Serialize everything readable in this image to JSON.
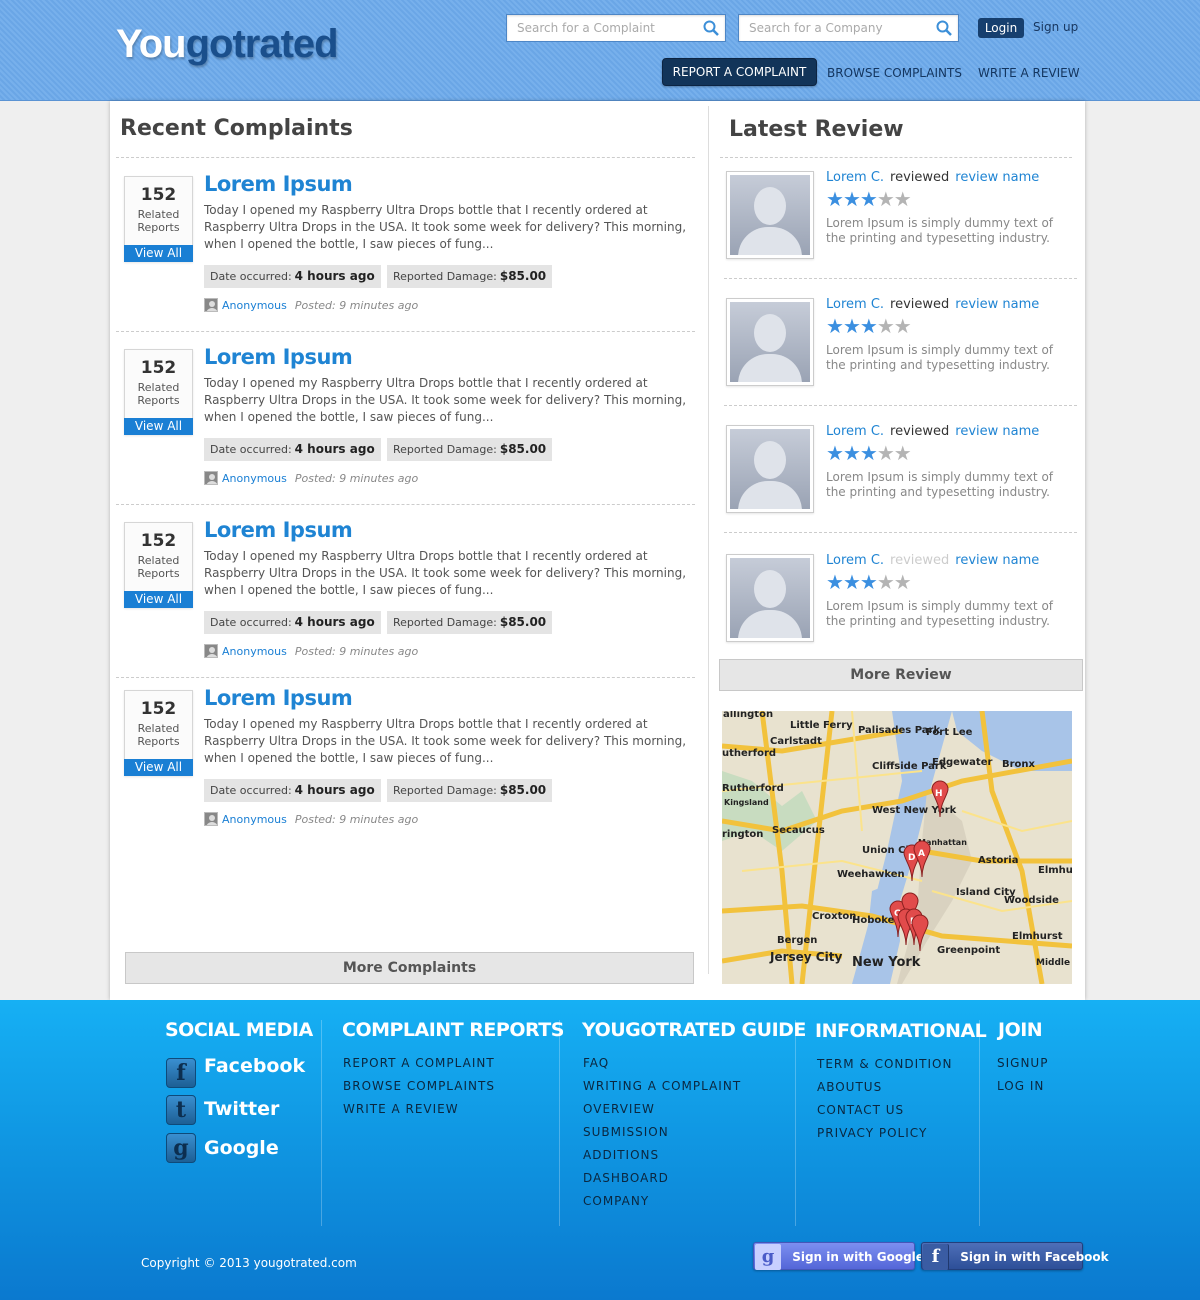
{
  "logo": {
    "part1": "You",
    "part2": "gotrated"
  },
  "header": {
    "search_complaint_placeholder": "Search for a Complaint",
    "search_company_placeholder": "Search for a Company",
    "login": "Login",
    "signup": "Sign up",
    "nav": [
      "REPORT A COMPLAINT",
      "BROWSE COMPLAINTS",
      "WRITE A REVIEW"
    ]
  },
  "recent": {
    "title": "Recent Complaints",
    "items": [
      {
        "count": "152",
        "related": "Related",
        "reports": "Reports",
        "view_all": "View All",
        "title": "Lorem Ipsum",
        "text": "Today I opened my Raspberry Ultra Drops bottle that I recently ordered at Raspberry Ultra Drops in the USA. It took some week for delivery? This morning,  when I opened the bottle, I saw pieces of fung...",
        "date_label": "Date occurred:",
        "date_value": "4 hours ago",
        "damage_label": "Reported Damage:",
        "damage_value": "$85.00",
        "poster": "Anonymous",
        "posted": "Posted: 9 minutes ago"
      },
      {
        "count": "152",
        "related": "Related",
        "reports": "Reports",
        "view_all": "View All",
        "title": "Lorem Ipsum",
        "text": "Today I opened my Raspberry Ultra Drops bottle that I recently ordered at Raspberry Ultra Drops in the USA. It took some week for delivery? This morning,  when I opened the bottle, I saw pieces of fung...",
        "date_label": "Date occurred:",
        "date_value": "4 hours ago",
        "damage_label": "Reported Damage:",
        "damage_value": "$85.00",
        "poster": "Anonymous",
        "posted": "Posted: 9 minutes ago"
      },
      {
        "count": "152",
        "related": "Related",
        "reports": "Reports",
        "view_all": "View All",
        "title": "Lorem Ipsum",
        "text": "Today I opened my Raspberry Ultra Drops bottle that I recently ordered at Raspberry Ultra Drops in the USA. It took some week for delivery? This morning,  when I opened the bottle, I saw pieces of fung...",
        "date_label": "Date occurred:",
        "date_value": "4 hours ago",
        "damage_label": "Reported Damage:",
        "damage_value": "$85.00",
        "poster": "Anonymous",
        "posted": "Posted: 9 minutes ago"
      },
      {
        "count": "152",
        "related": "Related",
        "reports": "Reports",
        "view_all": "View All",
        "title": "Lorem Ipsum",
        "text": "Today I opened my Raspberry Ultra Drops bottle that I recently ordered at Raspberry Ultra Drops in the USA. It took some week for delivery? This morning,  when I opened the bottle, I saw pieces of fung...",
        "date_label": "Date occurred:",
        "date_value": "4 hours ago",
        "damage_label": "Reported Damage:",
        "damage_value": "$85.00",
        "poster": "Anonymous",
        "posted": "Posted: 9 minutes ago"
      }
    ],
    "more": "More Complaints"
  },
  "reviews": {
    "title": "Latest Review",
    "items": [
      {
        "name": "Lorem C.",
        "reviewed": "reviewed",
        "link": "review name",
        "rating": 3,
        "max": 5,
        "text": "Lorem Ipsum is simply dummy text of the printing and typesetting industry."
      },
      {
        "name": "Lorem C.",
        "reviewed": "reviewed",
        "link": "review name",
        "rating": 3,
        "max": 5,
        "text": "Lorem Ipsum is simply dummy text of the printing and typesetting industry."
      },
      {
        "name": "Lorem C.",
        "reviewed": "reviewed",
        "link": "review name",
        "rating": 3,
        "max": 5,
        "text": "Lorem Ipsum is simply dummy text of the printing and typesetting industry."
      },
      {
        "name": "Lorem C.",
        "reviewed": "reviewed",
        "link": "review name",
        "rating": 3,
        "max": 5,
        "text": "Lorem Ipsum is simply dummy text of the printing and typesetting industry."
      }
    ],
    "more": "More Review"
  },
  "map": {
    "labels": [
      "allington",
      "Little Ferry",
      "Palisades Park",
      "Fort Lee",
      "Carlstadt",
      "utherford",
      "Cliffside Park",
      "Edgewater",
      "Bronx",
      "Rutherford",
      "Kingsland",
      "Union City",
      "West New York",
      "Secaucus",
      "rington",
      "Weehawken",
      "Hoboken",
      "Manhattan",
      "Astoria",
      "Elmhurst",
      "Island City",
      "Woodside",
      "Croxton",
      "Bergen",
      "Jersey City",
      "New York",
      "Greenpoint",
      "Middle Village",
      "Elmhurst"
    ],
    "markers": [
      "H",
      "D",
      "A",
      "C",
      "B"
    ]
  },
  "footer": {
    "social_title": "SOCIAL MEDIA",
    "social": [
      {
        "icon": "f",
        "label": "Facebook"
      },
      {
        "icon": "t",
        "label": "Twitter"
      },
      {
        "icon": "g",
        "label": "Google"
      }
    ],
    "reports_title": "COMPLAINT REPORTS",
    "reports": [
      "REPORT A COMPLAINT",
      "BROWSE COMPLAINTS",
      "WRITE A REVIEW"
    ],
    "guide_title": "YOUGOTRATED GUIDE",
    "guide": [
      "FAQ",
      "WRITING A COMPLAINT",
      "OVERVIEW",
      "SUBMISSION",
      "ADDITIONS",
      "DASHBOARD",
      "COMPANY"
    ],
    "info_title": "INFORMATIONAL",
    "info": [
      "TERM & CONDITION",
      "ABOUTUS",
      "CONTACT US",
      "PRIVACY POLICY"
    ],
    "join_title": "JOIN",
    "join": [
      "SIGNUP",
      "LOG IN"
    ],
    "copyright": "Copyright © 2013 yougotrated.com",
    "google_btn": "Sign in with Google",
    "facebook_btn": "Sign in with Facebook",
    "google_icon": "g",
    "facebook_icon": "f"
  }
}
